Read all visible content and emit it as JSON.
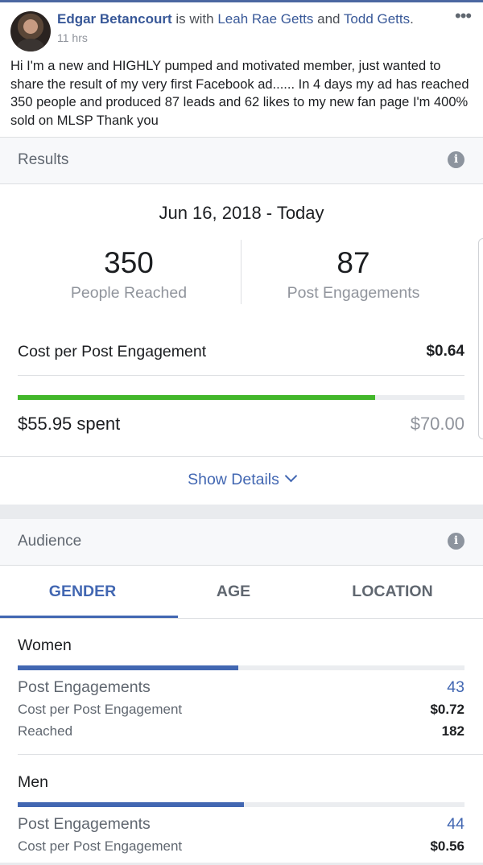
{
  "post": {
    "author": "Edgar Betancourt",
    "with_text": " is with ",
    "tagged_1": "Leah Rae Getts",
    "and_text": " and ",
    "tagged_2": "Todd Getts",
    "period": ".",
    "time": "11 hrs",
    "more_icon": "ellipsis-icon",
    "more_glyph": "•••",
    "body": "Hi I'm a new and HIGHLY pumped and motivated member, just wanted to share the result of my very first Facebook ad...... In 4 days my ad has reached 350 people and produced 87 leads and 62 likes to my new fan page I'm 400% sold on MLSP Thank you"
  },
  "results": {
    "title": "Results",
    "info_icon": "info-icon",
    "info_glyph": "i",
    "date_range": "Jun 16, 2018 - Today",
    "reached_value": "350",
    "reached_label": "People Reached",
    "engagements_value": "87",
    "engagements_label": "Post Engagements",
    "cost_label": "Cost per Post Engagement",
    "cost_value": "$0.64",
    "spent": "$55.95 spent",
    "budget": "$70.00",
    "spent_fraction": 0.8,
    "progress_color": "#42b72a",
    "show_details": "Show Details"
  },
  "audience": {
    "title": "Audience",
    "info_icon": "info-icon",
    "info_glyph": "i",
    "tabs": [
      "GENDER",
      "AGE",
      "LOCATION"
    ],
    "active_tab": "GENDER",
    "accent_color": "#4267b2",
    "groups": [
      {
        "name": "Women",
        "fraction": 0.494,
        "engagements_label": "Post Engagements",
        "engagements_value": "43",
        "cost_label": "Cost per Post Engagement",
        "cost_value": "$0.72",
        "reached_label": "Reached",
        "reached_value": "182"
      },
      {
        "name": "Men",
        "fraction": 0.506,
        "engagements_label": "Post Engagements",
        "engagements_value": "44",
        "cost_label": "Cost per Post Engagement",
        "cost_value": "$0.56"
      }
    ]
  }
}
